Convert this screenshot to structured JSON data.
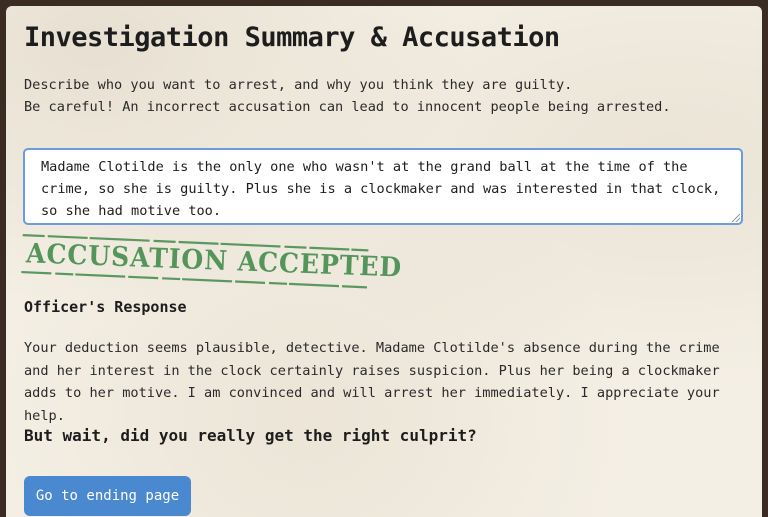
{
  "page": {
    "title": "Investigation Summary & Accusation",
    "intro_line_1": "Describe who you want to arrest, and why you think they are guilty.",
    "intro_line_2": "Be careful! An incorrect accusation can lead to innocent people being arrested."
  },
  "accusation": {
    "value": "Madame Clotilde is the only one who wasn't at the grand ball at the time of the crime, so she is guilty. Plus she is a clockmaker and was interested in that clock, so she had motive too."
  },
  "stamp": {
    "text": "ACCUSATION  ACCEPTED",
    "color": "#3f8a4a"
  },
  "officer": {
    "heading": "Officer's Response",
    "response": "Your deduction seems plausible, detective. Madame Clotilde's absence during the crime and her interest in the clock certainly raises suspicion. Plus her being a clockmaker adds to her motive. I am convinced and will arrest her immediately. I appreciate your help.",
    "question": "But wait, did you really get the right culprit?"
  },
  "actions": {
    "ending_button_label": "Go to ending page"
  },
  "colors": {
    "paper": "#f4efe4",
    "input_border": "#6d9be0",
    "button": "#4a89d0"
  }
}
